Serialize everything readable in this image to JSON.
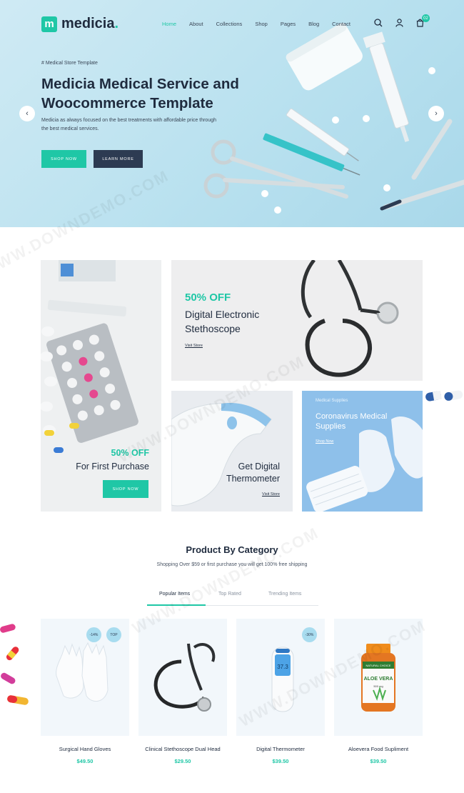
{
  "brand": {
    "name": "medicia",
    "mark": "m",
    "dot": "."
  },
  "nav": [
    "Home",
    "About",
    "Collections",
    "Shop",
    "Pages",
    "Blog",
    "Contact"
  ],
  "cart_count": "02",
  "hero": {
    "eyebrow": "# Medical Store Template",
    "title": "Medicia Medical Service and Woocommerce Template",
    "description": "Medicia as always focused on the best treatments with affordable price through the best medical services.",
    "shop_button": "SHOP NOW",
    "learn_button": "LEARN MORE"
  },
  "banners": {
    "first_purchase": {
      "off": "50% OFF",
      "title": "For First Purchase",
      "button": "SHOP NOW"
    },
    "stethoscope": {
      "off": "50% OFF",
      "title": "Digital Electronic Stethoscope",
      "link": "Visit Store"
    },
    "thermometer": {
      "title": "Get Digital Thermometer",
      "link": "Visit Store"
    },
    "supplies": {
      "eyebrow": "Medical Supplies",
      "title": "Coronavirus Medical Supplies",
      "link": "Shop Now"
    }
  },
  "category": {
    "title": "Product By Category",
    "subtitle": "Shopping Over $59 or first purchase you will get 100% free shipping",
    "tabs": [
      "Popular Items",
      "Top Rated",
      "Trending Items"
    ]
  },
  "products": [
    {
      "name": "Surgical Hand Gloves",
      "price": "$49.50",
      "tags": [
        "-14%",
        "TOP"
      ]
    },
    {
      "name": "Clinical Stethoscope Dual Head",
      "price": "$29.50",
      "tags": []
    },
    {
      "name": "Digital Thermometer",
      "price": "$39.50",
      "tags": [
        "-30%"
      ]
    },
    {
      "name": "Aloevera Food Supliment",
      "price": "$39.50",
      "tags": []
    }
  ],
  "product_images": {
    "thermometer_display": "37.3",
    "bottle_label": "ALOE VERA",
    "bottle_brand": "NATURAL CHOICE",
    "bottle_size": "500 mg"
  },
  "watermark": "WWW.DOWNDEMO.COM",
  "colors": {
    "accent": "#1fc7a6",
    "dark": "#1f2b3e",
    "hero_bg": "#b9e1ef"
  }
}
